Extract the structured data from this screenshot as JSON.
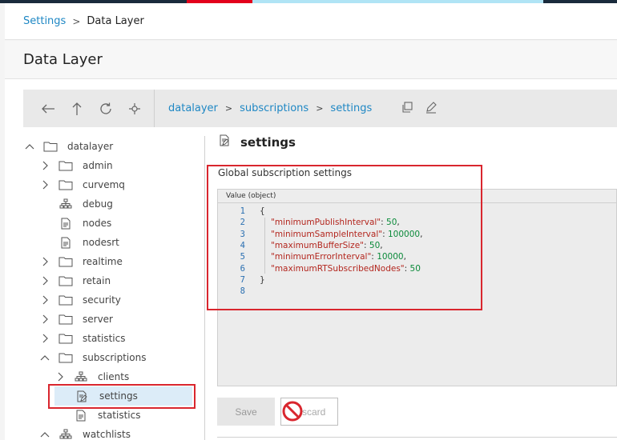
{
  "colors": {
    "strip": [
      "#1a2b3c",
      "#e3001b",
      "#b0e4f5",
      "#1a2b3c"
    ],
    "link": "#1e87c4",
    "highlight": "#d9262e",
    "selected_row": "#dcecf8"
  },
  "breadcrumb": {
    "root": "Settings",
    "separator": ">",
    "current": "Data Layer"
  },
  "page_title": "Data Layer",
  "toolbar": {
    "icons": [
      "back-arrow-icon",
      "up-arrow-icon",
      "refresh-icon",
      "locate-icon"
    ],
    "path": [
      "datalayer",
      "subscriptions",
      "settings"
    ],
    "path_separator": ">",
    "actions": [
      "copy-icon",
      "edit-icon"
    ]
  },
  "tree": {
    "items": [
      {
        "label": "datalayer",
        "icon": "folder-icon",
        "chevron": "up"
      },
      {
        "label": "admin",
        "icon": "folder-icon",
        "chevron": "right"
      },
      {
        "label": "curvemq",
        "icon": "folder-icon",
        "chevron": "right"
      },
      {
        "label": "debug",
        "icon": "node-tree-icon",
        "chevron": ""
      },
      {
        "label": "nodes",
        "icon": "document-icon",
        "chevron": ""
      },
      {
        "label": "nodesrt",
        "icon": "document-icon",
        "chevron": ""
      },
      {
        "label": "realtime",
        "icon": "folder-icon",
        "chevron": "right"
      },
      {
        "label": "retain",
        "icon": "folder-icon",
        "chevron": "right"
      },
      {
        "label": "security",
        "icon": "folder-icon",
        "chevron": "right"
      },
      {
        "label": "server",
        "icon": "folder-icon",
        "chevron": "right"
      },
      {
        "label": "statistics",
        "icon": "folder-icon",
        "chevron": "right"
      },
      {
        "label": "subscriptions",
        "icon": "folder-icon",
        "chevron": "up"
      },
      {
        "label": "clients",
        "icon": "node-tree-icon",
        "chevron": "right"
      },
      {
        "label": "settings",
        "icon": "edit-document-icon",
        "chevron": "",
        "selected": true
      },
      {
        "label": "statistics",
        "icon": "document-icon",
        "chevron": ""
      },
      {
        "label": "watchlists",
        "icon": "node-tree-icon",
        "chevron": "up"
      }
    ]
  },
  "panel": {
    "title": "settings",
    "section_label": "Global subscription settings",
    "editor_header": "Value (object)",
    "lines": [
      {
        "n": "1",
        "text": "{"
      },
      {
        "n": "2",
        "key": "\"minimumPublishInterval\"",
        "value": "50",
        "trail": ","
      },
      {
        "n": "3",
        "key": "\"minimumSampleInterval\"",
        "value": "100000",
        "trail": ","
      },
      {
        "n": "4",
        "key": "\"maximumBufferSize\"",
        "value": "50",
        "trail": ","
      },
      {
        "n": "5",
        "key": "\"minimumErrorInterval\"",
        "value": "10000",
        "trail": ","
      },
      {
        "n": "6",
        "key": "\"maximumRTSubscribedNodes\"",
        "value": "50",
        "trail": ""
      },
      {
        "n": "7",
        "text": "}"
      },
      {
        "n": "8",
        "text": ""
      }
    ]
  },
  "buttons": {
    "save": "Save",
    "discard": "Discard"
  }
}
